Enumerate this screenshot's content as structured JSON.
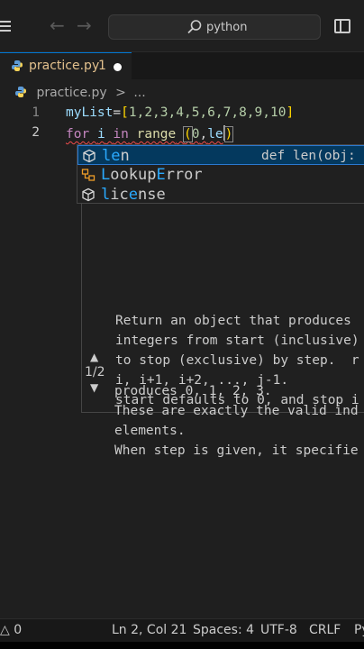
{
  "titlebar": {
    "search_text": "python"
  },
  "tabs": [
    {
      "label": "practice.py",
      "count": "1"
    }
  ],
  "breadcrumb": {
    "file": "practice.py",
    "separator": ">",
    "more": "..."
  },
  "code": {
    "line_numbers": [
      "1",
      "2"
    ],
    "line1": {
      "name": "myList",
      "eq": "=",
      "open": "[",
      "items": "1,2,3,4,5,6,7,8,9,10",
      "close": "]"
    },
    "line2": {
      "kw_for": "for",
      "var_i": "i",
      "kw_in": "in",
      "fn_range": "range",
      "open": "(",
      "arg0": "0",
      "comma": ",",
      "partial": "le",
      "close": ")"
    }
  },
  "suggest": {
    "items": [
      {
        "match": "le",
        "rest": "n",
        "detail": "def len(obj:",
        "kind": "cube-icon"
      },
      {
        "match": "L",
        "rest_a": "ookup",
        "match2": "E",
        "rest_b": "rror",
        "kind": "class-icon"
      },
      {
        "match": "l",
        "rest_a": "ic",
        "match2": "e",
        "rest_b": "nse",
        "kind": "cube-icon"
      }
    ]
  },
  "signature_help": {
    "lines": [
      "Return an object that produces",
      "integers from start (inclusive)",
      "to stop (exclusive) by step.  r",
      "i, i+1, i+2, ..., j-1.",
      "start defaults to 0, and stop i",
      "produces 0, 1, 2, 3.",
      "These are exactly the valid ind",
      "elements.",
      "When step is given, it specifie"
    ],
    "counter": "1/2"
  },
  "statusbar": {
    "problems": "△ 0",
    "position": "Ln 2, Col 21",
    "spaces": "Spaces: 4",
    "encoding": "UTF-8",
    "eol": "CRLF",
    "language": "Py"
  },
  "colors": {
    "accent": "#0078d4",
    "match_highlight": "#2aaaff",
    "tab_modified": "#e2c08d",
    "error_squiggle": "#f14c4c"
  }
}
